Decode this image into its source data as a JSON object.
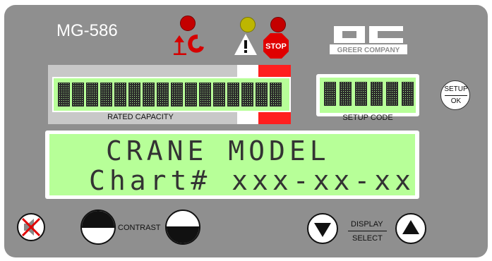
{
  "model": "MG-586",
  "logo_text": "GREER COMPANY",
  "rated_capacity_label": "RATED CAPACITY",
  "setup_code_label": "SETUP CODE",
  "setup_ok": {
    "top": "SETUP",
    "bottom": "OK"
  },
  "lcd": {
    "line1": "CRANE MODEL",
    "line2": "Chart# xxx-xx-xx"
  },
  "contrast_label": "CONTRAST",
  "display_select": {
    "top": "DISPLAY",
    "bottom": "SELECT"
  },
  "stop_label": "STOP",
  "colors": {
    "panel": "#8f8f8f",
    "lcd": "#b7ff98",
    "red": "#d60000",
    "yellow": "#bdb600"
  }
}
